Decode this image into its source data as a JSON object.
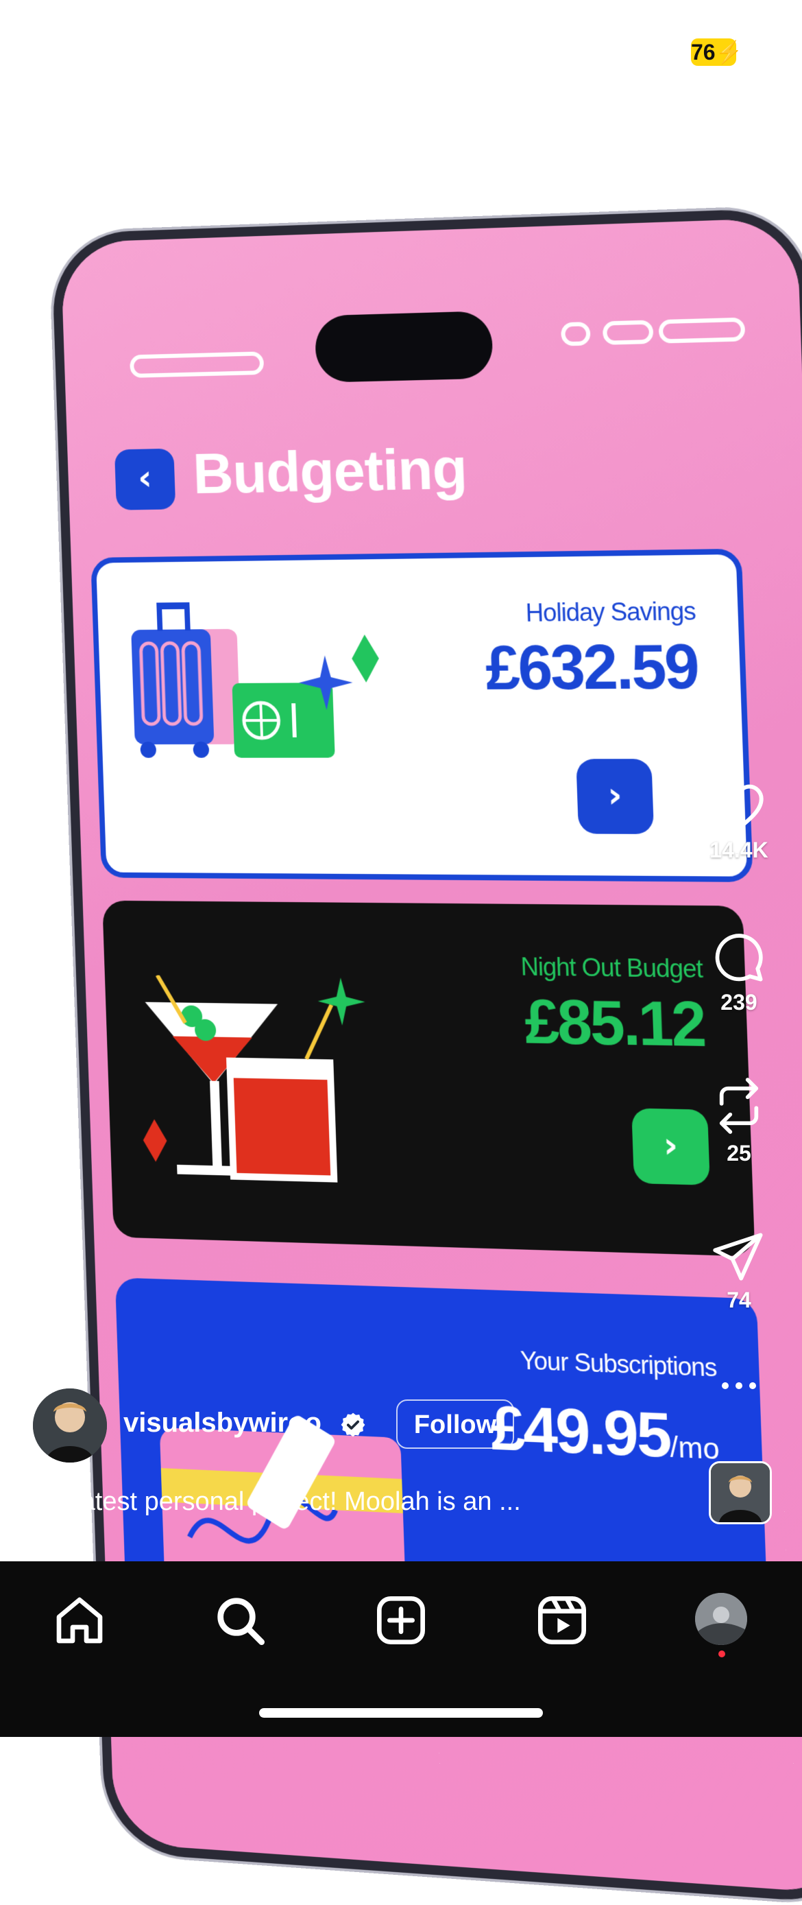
{
  "status_bar": {
    "battery": "76"
  },
  "app": {
    "back_icon": "chevron-left-icon",
    "title": "Budgeting",
    "cards": [
      {
        "label": "Holiday Savings",
        "amount": "£632.59",
        "color": "#1a46d4",
        "illustration": "suitcase-and-ticket"
      },
      {
        "label": "Night Out Budget",
        "amount": "£85.12",
        "color": "#22c55e",
        "illustration": "cocktails"
      },
      {
        "label": "Your Subscriptions",
        "amount": "£49.95",
        "period": "/mo",
        "color": "#1840e0",
        "illustration": "cards"
      }
    ]
  },
  "reel": {
    "likes": "14.4K",
    "comments": "239",
    "reposts": "25",
    "shares": "74",
    "author": "visualsbywiroo",
    "follow_label": "Follow",
    "caption": "My latest personal project! Moolah is an ..."
  },
  "tab_bar": {
    "items": [
      "home-icon",
      "search-icon",
      "create-icon",
      "reels-icon",
      "profile-avatar"
    ]
  }
}
